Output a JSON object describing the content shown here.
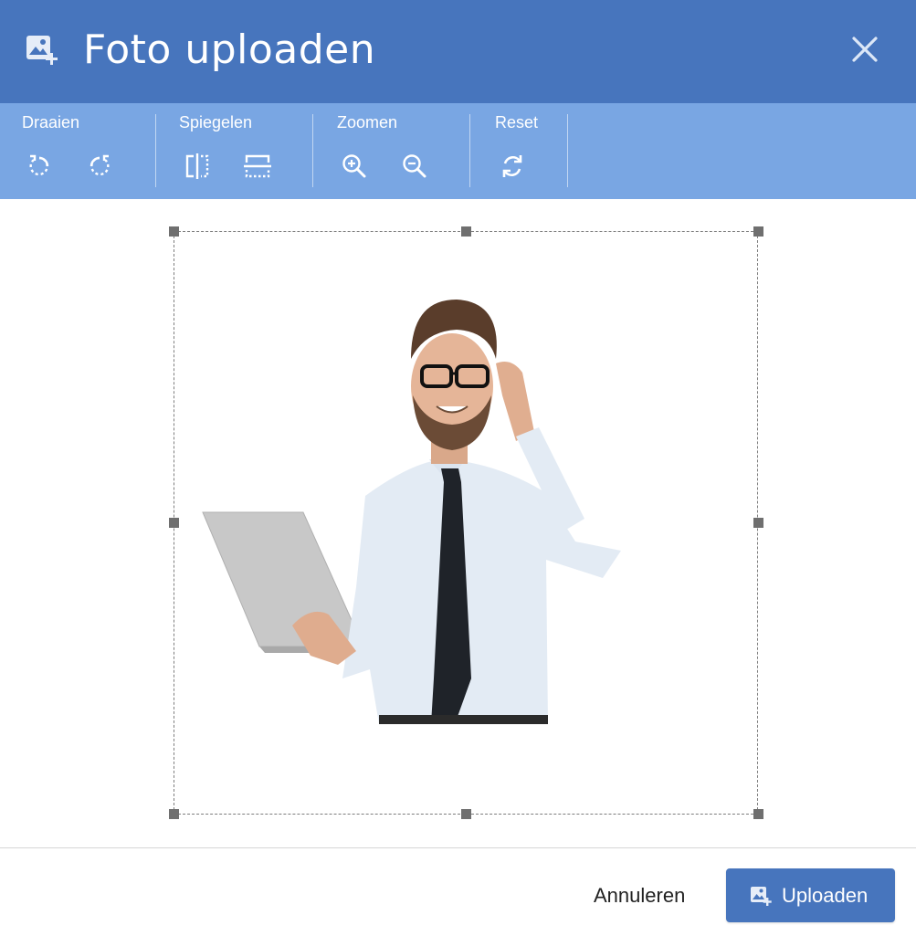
{
  "dialog": {
    "title": "Foto uploaden",
    "title_icon": "image-add-icon",
    "close_icon": "close-icon"
  },
  "toolbar": {
    "groups": [
      {
        "label": "Draaien",
        "buttons": [
          {
            "icon": "rotate-left-icon"
          },
          {
            "icon": "rotate-right-icon"
          }
        ]
      },
      {
        "label": "Spiegelen",
        "buttons": [
          {
            "icon": "flip-horizontal-icon"
          },
          {
            "icon": "flip-vertical-icon"
          }
        ]
      },
      {
        "label": "Zoomen",
        "buttons": [
          {
            "icon": "zoom-in-icon"
          },
          {
            "icon": "zoom-out-icon"
          }
        ]
      },
      {
        "label": "Reset",
        "buttons": [
          {
            "icon": "reset-icon"
          }
        ]
      }
    ]
  },
  "footer": {
    "cancel_label": "Annuleren",
    "upload_label": "Uploaden",
    "upload_icon": "image-add-icon"
  },
  "colors": {
    "header": "#4775bd",
    "toolbar": "#79a6e3",
    "primary_button": "#4775bd",
    "crop_handle": "#6f6f6f"
  }
}
